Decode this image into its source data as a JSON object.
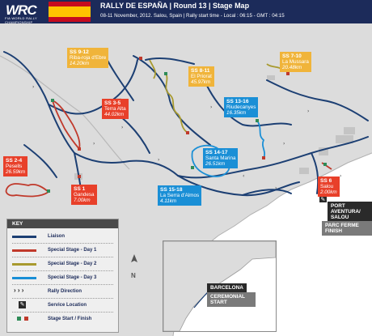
{
  "header": {
    "logo_text": "WRC",
    "logo_sub": "FIA WORLD RALLY CHAMPIONSHIP",
    "title": "RALLY DE ESPAÑA  |  Round 13  |  Stage Map",
    "subtitle": "08-11 November, 2012. Salou, Spain  |  Rally start time - Local : 06:15 - GMT : 04:15"
  },
  "colors": {
    "liaison": "#1c3f73",
    "day1": "#c0392b",
    "day2": "#a89a2f",
    "day3": "#1a8fd6",
    "header": "#1c2b5a"
  },
  "stages": {
    "ss912": {
      "name": "SS 9-12",
      "place": "Riba-roja d'Ebre",
      "dist": "14.20km"
    },
    "ss811": {
      "name": "SS 8-11",
      "place": "El Priorat",
      "dist": "45.97km"
    },
    "ss710": {
      "name": "SS 7-10",
      "place": "La Mussara",
      "dist": "20.48km"
    },
    "ss35": {
      "name": "SS 3-5",
      "place": "Terra Alta",
      "dist": "44.02km"
    },
    "ss1316": {
      "name": "SS 13-16",
      "place": "Riudecanyes",
      "dist": "16.35km"
    },
    "ss24": {
      "name": "SS 2-4",
      "place": "Pesells",
      "dist": "26.59km"
    },
    "ss1": {
      "name": "SS 1",
      "place": "Gandesa",
      "dist": "7.00km"
    },
    "ss1417": {
      "name": "SS 14-17",
      "place": "Santa Marina",
      "dist": "26.51km"
    },
    "ss1518": {
      "name": "SS 15-18",
      "place": "La Serra d'Almos",
      "dist": "4.11km"
    },
    "ss6": {
      "name": "SS 6",
      "place": "Salou",
      "dist": "2.00km"
    }
  },
  "points": {
    "port_aventura": "PORT AVENTURA/ SALOU",
    "parc_ferme": "PARC FERME FINISH",
    "barcelona": "BARCELONA",
    "ceremonial": "CEREMONIAL START"
  },
  "key": {
    "title": "KEY",
    "items": [
      {
        "label": "Liaison",
        "icon": "liaison-line"
      },
      {
        "label": "Special Stage - Day 1",
        "icon": "day1-line"
      },
      {
        "label": "Special Stage - Day 2",
        "icon": "day2-line"
      },
      {
        "label": "Special Stage - Day 3",
        "icon": "day3-line"
      },
      {
        "label": "Rally Direction",
        "icon": "chevron-arrows-icon"
      },
      {
        "label": "Service Location",
        "icon": "wrench-icon"
      },
      {
        "label": "Stage Start / Finish",
        "icon": "start-finish-squares-icon"
      }
    ]
  },
  "compass": "N"
}
